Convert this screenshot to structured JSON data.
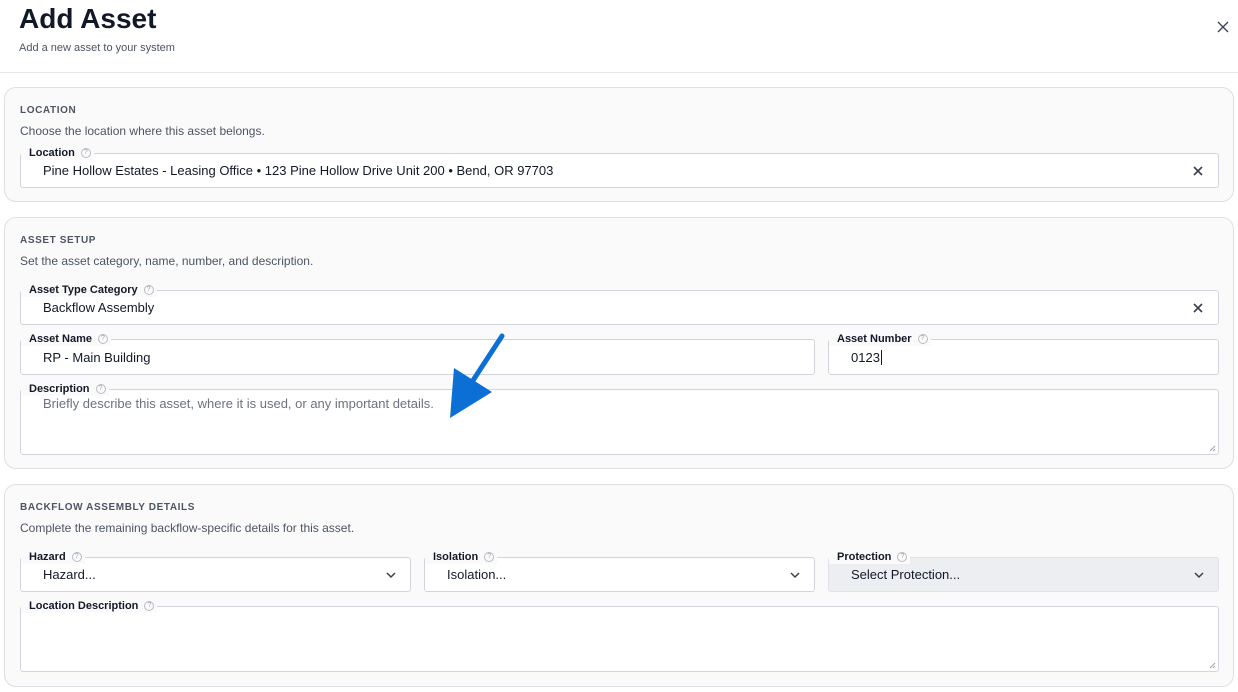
{
  "header": {
    "title": "Add Asset",
    "subtitle": "Add a new asset to your system"
  },
  "location_section": {
    "title": "LOCATION",
    "description": "Choose the location where this asset belongs.",
    "location": {
      "label": "Location",
      "value": "Pine Hollow Estates - Leasing Office • 123 Pine Hollow Drive Unit 200 • Bend, OR 97703"
    }
  },
  "asset_setup": {
    "title": "ASSET SETUP",
    "description": "Set the asset category, name, number, and description.",
    "type_category": {
      "label": "Asset Type Category",
      "value": "Backflow Assembly"
    },
    "asset_name": {
      "label": "Asset Name",
      "value": "RP - Main Building"
    },
    "asset_number": {
      "label": "Asset Number",
      "value": "0123"
    },
    "description_field": {
      "label": "Description",
      "placeholder": "Briefly describe this asset, where it is used, or any important details."
    }
  },
  "backflow_details": {
    "title": "BACKFLOW ASSEMBLY DETAILS",
    "description": "Complete the remaining backflow-specific details for this asset.",
    "hazard": {
      "label": "Hazard",
      "value": "Hazard..."
    },
    "isolation": {
      "label": "Isolation",
      "value": "Isolation..."
    },
    "protection": {
      "label": "Protection",
      "value": "Select Protection..."
    },
    "location_description": {
      "label": "Location Description"
    }
  },
  "help_glyph": "?",
  "colors": {
    "accent_arrow": "#0b6fd6"
  }
}
